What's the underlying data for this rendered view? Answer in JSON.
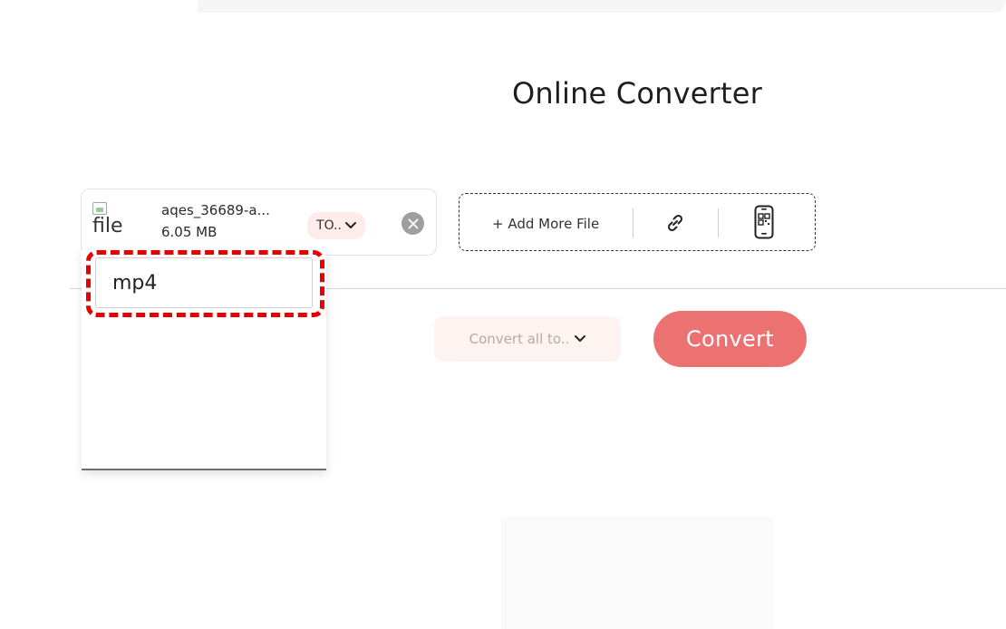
{
  "header": {
    "title": "Online Converter"
  },
  "file": {
    "thumb_alt": "file",
    "name": "aqes_36689-a...",
    "size": "6.05 MB",
    "to_label": "TO.."
  },
  "add_panel": {
    "add_more_label": "+ Add More File"
  },
  "actions": {
    "convert_all_label": "Convert all to..",
    "convert_label": "Convert"
  },
  "dropdown": {
    "search_value": "mp4"
  },
  "colors": {
    "accent": "#ec7272",
    "highlight": "#e60000",
    "to_bg": "#fdecea"
  },
  "icons": [
    "chevron-down-icon",
    "close-icon",
    "link-icon",
    "qr-phone-icon",
    "broken-image-icon"
  ]
}
